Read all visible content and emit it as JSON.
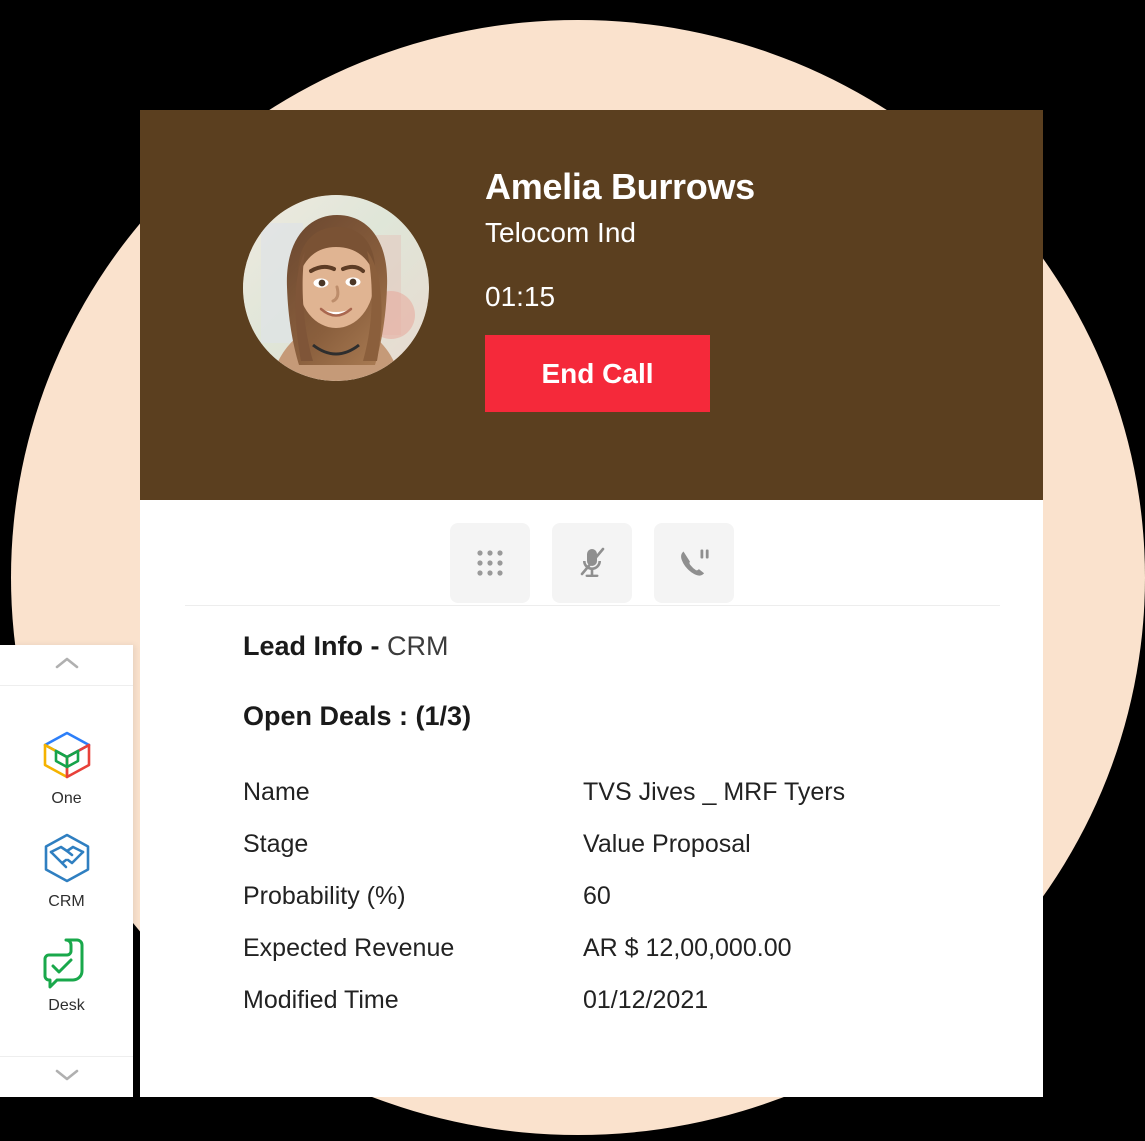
{
  "theme": {
    "background": "#000000",
    "decor_circle": "#FAE2CD",
    "header_brown": "#5B3F1F",
    "accent_red": "#F5293A",
    "card_white": "#FFFFFF"
  },
  "call": {
    "caller_name": "Amelia Burrows",
    "company": "Telocom Ind",
    "timer": "01:15",
    "end_call_label": "End Call",
    "avatar_alt": "caller-photo"
  },
  "controls": [
    {
      "name": "keypad-button",
      "icon": "keypad-icon"
    },
    {
      "name": "mute-button",
      "icon": "microphone-muted-icon"
    },
    {
      "name": "hold-button",
      "icon": "call-hold-icon"
    }
  ],
  "lead": {
    "title_strong": "Lead Info - ",
    "title_light": "CRM",
    "deals_title": "Open Deals : (1/3)",
    "fields": [
      {
        "label": "Name",
        "value": "TVS Jives _ MRF Tyers"
      },
      {
        "label": "Stage",
        "value": "Value Proposal"
      },
      {
        "label": "Probability (%)",
        "value": "60"
      },
      {
        "label": "Expected Revenue",
        "value": "AR $ 12,00,000.00"
      },
      {
        "label": "Modified Time",
        "value": "01/12/2021"
      }
    ]
  },
  "sidebar": {
    "scroll_up_icon": "chevron-up-icon",
    "scroll_down_icon": "chevron-down-icon",
    "apps": [
      {
        "label": "One",
        "icon": "zoho-one-cube-icon"
      },
      {
        "label": "CRM",
        "icon": "zoho-crm-handshake-icon"
      },
      {
        "label": "Desk",
        "icon": "zoho-desk-icon"
      }
    ]
  }
}
